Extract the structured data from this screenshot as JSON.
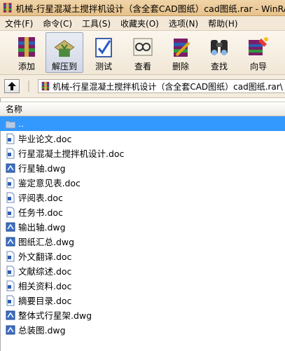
{
  "window": {
    "title": "机械-行星混凝土搅拌机设计（含全套CAD图纸）cad图纸.rar - WinRAR"
  },
  "menu": [
    {
      "label": "文件(F)"
    },
    {
      "label": "命令(C)"
    },
    {
      "label": "工具(S)"
    },
    {
      "label": "收藏夹(O)"
    },
    {
      "label": "选项(N)"
    },
    {
      "label": "帮助(H)"
    }
  ],
  "toolbar": [
    {
      "label": "添加",
      "icon": "add-icon"
    },
    {
      "label": "解压到",
      "icon": "extract-icon"
    },
    {
      "label": "测试",
      "icon": "test-icon"
    },
    {
      "label": "查看",
      "icon": "view-icon"
    },
    {
      "label": "删除",
      "icon": "delete-icon"
    },
    {
      "label": "查找",
      "icon": "find-icon"
    },
    {
      "label": "向导",
      "icon": "wizard-icon"
    }
  ],
  "path": {
    "text": "机械-行星混凝土搅拌机设计（含全套CAD图纸）cad图纸.rar\\"
  },
  "list": {
    "column_name": "名称",
    "items": [
      {
        "name": "..",
        "type": "folder-up",
        "selected": true
      },
      {
        "name": "毕业论文.doc",
        "type": "doc"
      },
      {
        "name": "行星混凝土搅拌机设计.doc",
        "type": "doc"
      },
      {
        "name": "行星轴.dwg",
        "type": "dwg"
      },
      {
        "name": "鉴定意见表.doc",
        "type": "doc"
      },
      {
        "name": "评阅表.doc",
        "type": "doc"
      },
      {
        "name": "任务书.doc",
        "type": "doc"
      },
      {
        "name": "输出轴.dwg",
        "type": "dwg"
      },
      {
        "name": "图纸汇总.dwg",
        "type": "dwg"
      },
      {
        "name": "外文翻译.doc",
        "type": "doc"
      },
      {
        "name": "文献综述.doc",
        "type": "doc"
      },
      {
        "name": "相关资料.doc",
        "type": "doc"
      },
      {
        "name": "摘要目录.doc",
        "type": "doc"
      },
      {
        "name": "整体式行星架.dwg",
        "type": "dwg"
      },
      {
        "name": "总装图.dwg",
        "type": "dwg"
      }
    ]
  }
}
